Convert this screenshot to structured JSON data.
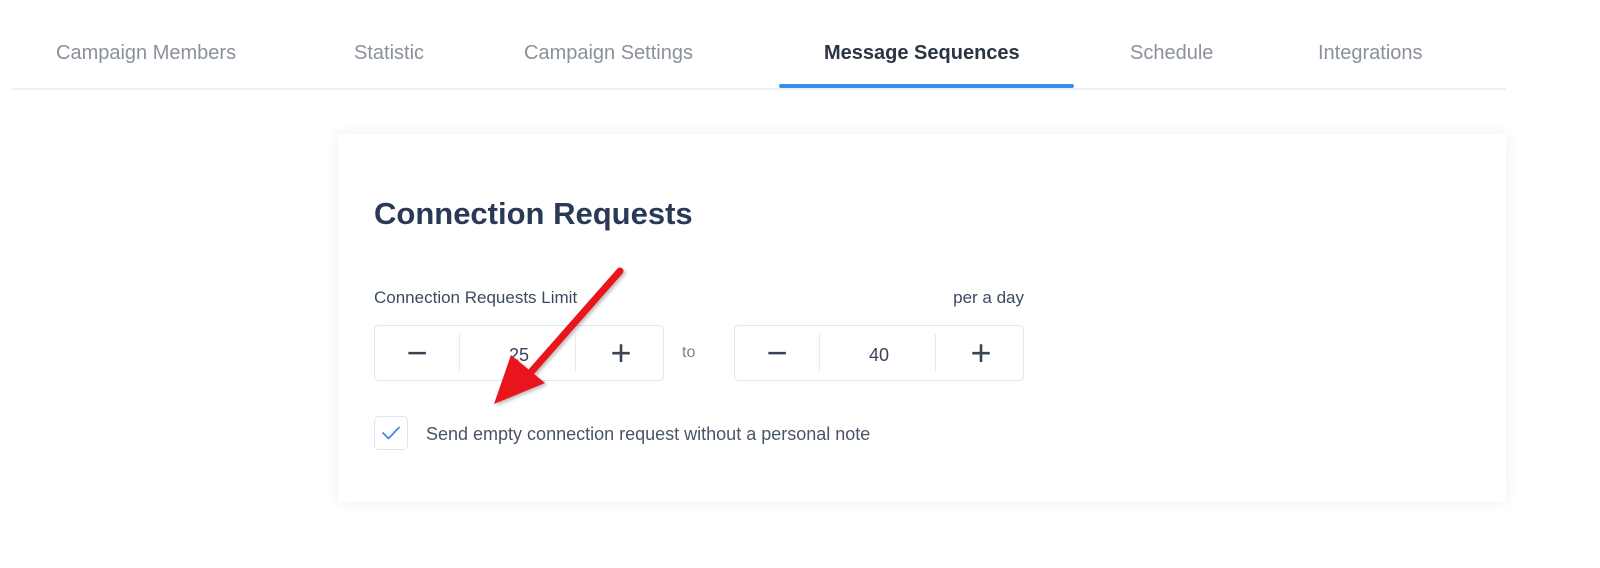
{
  "tabs": [
    {
      "label": "Campaign Members",
      "active": false
    },
    {
      "label": "Statistic",
      "active": false
    },
    {
      "label": "Campaign Settings",
      "active": false
    },
    {
      "label": "Message Sequences",
      "active": true
    },
    {
      "label": "Schedule",
      "active": false
    },
    {
      "label": "Integrations",
      "active": false
    }
  ],
  "section": {
    "title": "Connection Requests",
    "limit_label": "Connection Requests Limit",
    "per_day_label": "per a day",
    "min_value": "25",
    "to_label": "to",
    "max_value": "40",
    "minus_glyph": "−",
    "plus_glyph": "+",
    "empty_request_checked": true,
    "empty_request_label": "Send empty connection request without a personal note"
  },
  "icons": {
    "check": "checkmark-icon",
    "annotation": "red-arrow-annotation"
  },
  "colors": {
    "accent": "#3b8ded",
    "annotation_arrow": "#e8141a",
    "title": "#2a3a56"
  }
}
